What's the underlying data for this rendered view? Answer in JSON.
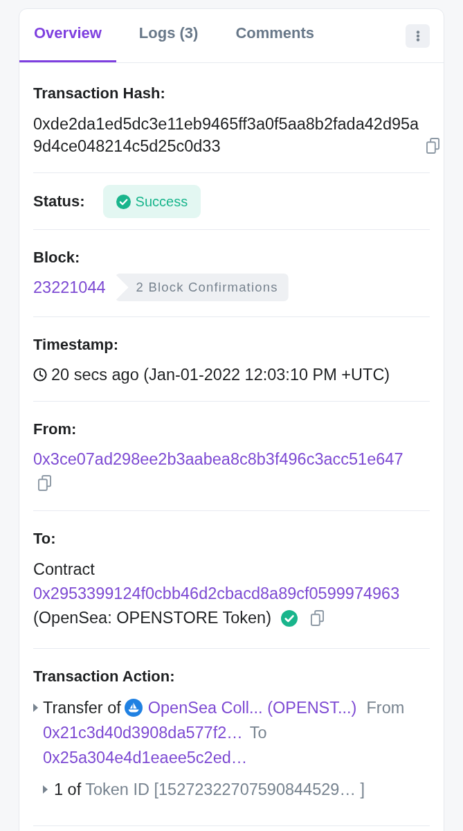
{
  "tabs": [
    {
      "label": "Overview",
      "selected": true
    },
    {
      "label": "Logs (3)",
      "selected": false
    },
    {
      "label": "Comments",
      "selected": false
    }
  ],
  "sections": [
    {
      "kind": "hash",
      "label": "Transaction Hash:",
      "value": "0xde2da1ed5dc3e11eb9465ff3a0f5aa8b2fada42d95a9d4ce048214c5d25c0d33"
    },
    {
      "kind": "status",
      "label": "Status:",
      "status": "Success"
    },
    {
      "kind": "block",
      "label": "Block:",
      "block": "23221044",
      "confirmations": "2 Block Confirmations"
    },
    {
      "kind": "timestamp",
      "label": "Timestamp:",
      "value": "20 secs ago (Jan-01-2022 12:03:10 PM +UTC)"
    },
    {
      "kind": "address",
      "label": "From:",
      "address": "0x3ce07ad298ee2b3aabea8c8b3f496c3acc51e647"
    },
    {
      "kind": "contract",
      "label": "To:",
      "account_label": "Contract",
      "address": "0x2953399124f0cbb46d2cbacd8a89cf0599974963",
      "name": "(OpenSea: OPENSTORE Token)",
      "verified": true
    },
    {
      "kind": "action",
      "label": "Transaction Action:",
      "expanded": false,
      "text": "Transfer of",
      "token": "OpenSea Coll... (OPENST...)",
      "from_label": "From",
      "from": "0x21c3d40d3908da577f2…",
      "to_label": "To",
      "to": "0x25a304e4d1eaee5c2ed…",
      "items": [
        {
          "expanded": false,
          "quantity": "1 of",
          "token_id": "Token ID [15272322707590844529… ]"
        }
      ]
    }
  ]
}
